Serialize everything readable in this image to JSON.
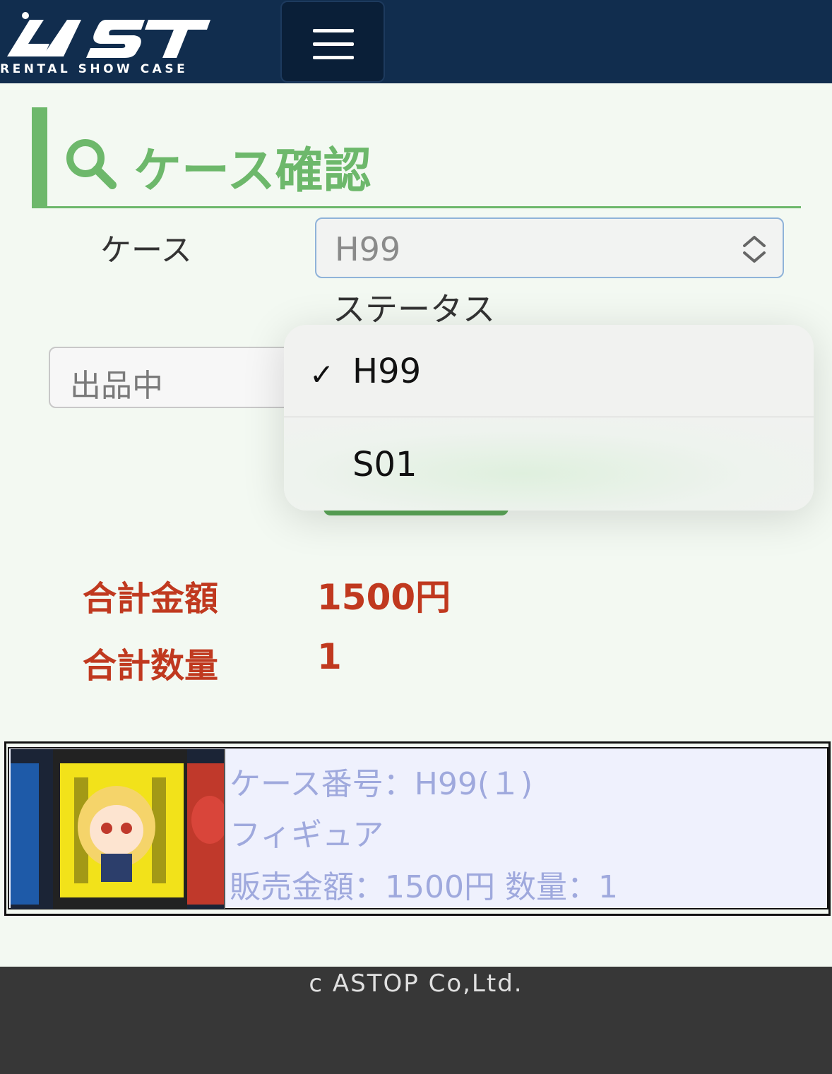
{
  "header": {
    "logo_text": "AST",
    "logo_subtitle": "RENTAL SHOW CASE",
    "menu_icon": "hamburger-menu-icon"
  },
  "page": {
    "title": "ケース確認",
    "title_icon": "search-icon",
    "accent_color": "#6db86b"
  },
  "form": {
    "case_label": "ケース",
    "case_value": "H99",
    "status_label": "ステータス",
    "status_value": "出品中"
  },
  "dropdown": {
    "options": [
      {
        "label": "H99",
        "selected": true
      },
      {
        "label": "S01",
        "selected": false
      }
    ],
    "check_glyph": "✓"
  },
  "totals": {
    "amount_label": "合計金額",
    "amount_value": "1500円",
    "quantity_label": "合計数量",
    "quantity_value": "1",
    "color": "#c0391f"
  },
  "items": [
    {
      "case_line": "ケース番号：H99(１)",
      "category": "フィギュア",
      "price_line": "販売金額：1500円 数量：1"
    }
  ],
  "footer": {
    "copyright": "c ASTOP Co,Ltd."
  }
}
